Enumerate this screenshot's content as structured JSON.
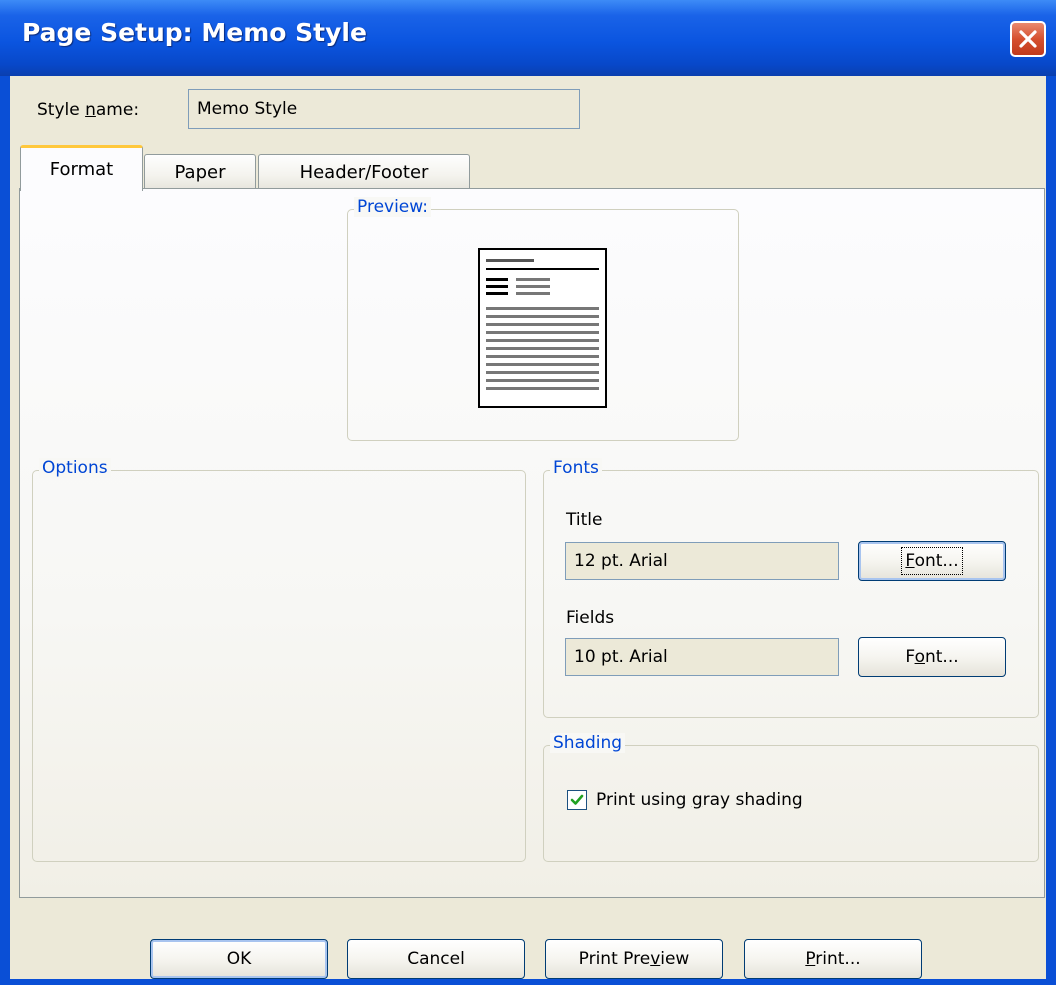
{
  "window": {
    "title": "Page Setup: Memo Style",
    "close_icon": "close-icon"
  },
  "style_name": {
    "label_prefix": "Style ",
    "label_mnemonic": "n",
    "label_suffix": "ame:",
    "value": "Memo Style"
  },
  "tabs": [
    {
      "label": "Format",
      "active": true
    },
    {
      "label": "Paper",
      "active": false
    },
    {
      "label": "Header/Footer",
      "active": false
    }
  ],
  "preview": {
    "title": "Preview:",
    "icon": "memo-page-preview-icon"
  },
  "options": {
    "title": "Options"
  },
  "fonts": {
    "title": "Fonts",
    "title_label": "Title",
    "title_value": "12 pt. Arial",
    "title_button_mnemonic": "F",
    "title_button_rest": "ont...",
    "fields_label": "Fields",
    "fields_value": "10 pt. Arial",
    "fields_button_pre": "F",
    "fields_button_mnemonic": "o",
    "fields_button_rest": "nt..."
  },
  "shading": {
    "title": "Shading",
    "checkbox_pre": "Print using ",
    "checkbox_mnemonic": "g",
    "checkbox_rest": "ray shading",
    "checked": true,
    "check_color": "#21a121"
  },
  "buttons": {
    "ok": "OK",
    "cancel": "Cancel",
    "print_preview_pre": "Print Pre",
    "print_preview_mnemonic": "v",
    "print_preview_rest": "iew",
    "print_mnemonic": "P",
    "print_rest": "rint..."
  },
  "colors": {
    "titlebar": "#0b55e0",
    "dialog_bg": "#ece9d8",
    "group_title": "#0046d5",
    "tab_highlight": "#ffc83c"
  }
}
